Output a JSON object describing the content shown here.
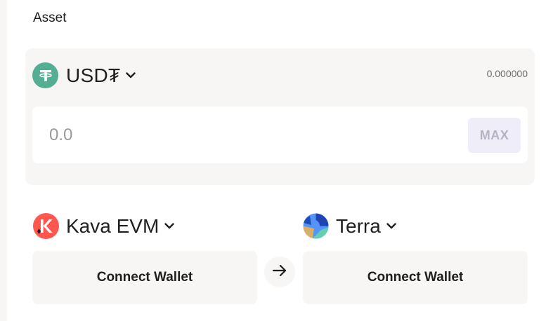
{
  "asset": {
    "label": "Asset",
    "token": {
      "name": "USD₮",
      "icon": "tether-icon",
      "icon_color": "#53ae94"
    },
    "balance": "0.000000",
    "amount_placeholder": "0.0",
    "max_label": "MAX"
  },
  "source_chain": {
    "name": "Kava EVM",
    "icon": "kava-icon",
    "icon_color": "#ff564f",
    "wallet_label": "Connect Wallet"
  },
  "destination_chain": {
    "name": "Terra",
    "icon": "terra-icon",
    "icon_color": "#2043b5",
    "wallet_label": "Connect Wallet"
  },
  "direction_icon": "arrow-right-icon"
}
